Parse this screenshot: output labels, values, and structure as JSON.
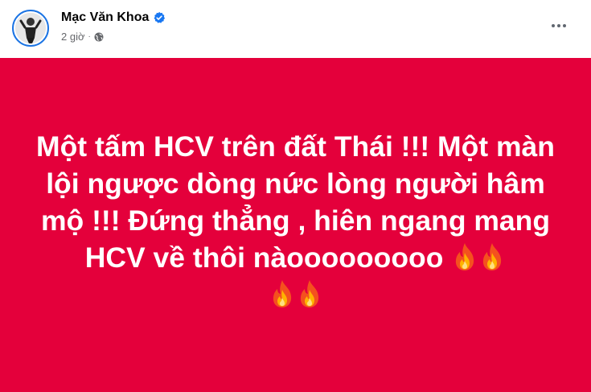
{
  "post": {
    "author": {
      "name": "Mạc Văn Khoa",
      "verified": true,
      "avatar_icon": "avatar-photo"
    },
    "meta": {
      "time": "2 giờ",
      "separator": "·",
      "privacy_icon": "globe-icon"
    },
    "more_icon": "more-horizontal-icon",
    "body": {
      "background_color": "#e4003b",
      "text_color": "#ffffff",
      "text": "Một tấm HCV trên đất Thái !!! Một màn lội ngược dòng nức lòng người hâm mộ !!! Đứng thẳng , hiên ngang mang HCV về thôi nàooooooooo",
      "emoji": [
        "fire",
        "fire",
        "fire",
        "fire"
      ]
    }
  },
  "colors": {
    "verified_blue": "#1877f2",
    "meta_gray": "#65676b"
  }
}
